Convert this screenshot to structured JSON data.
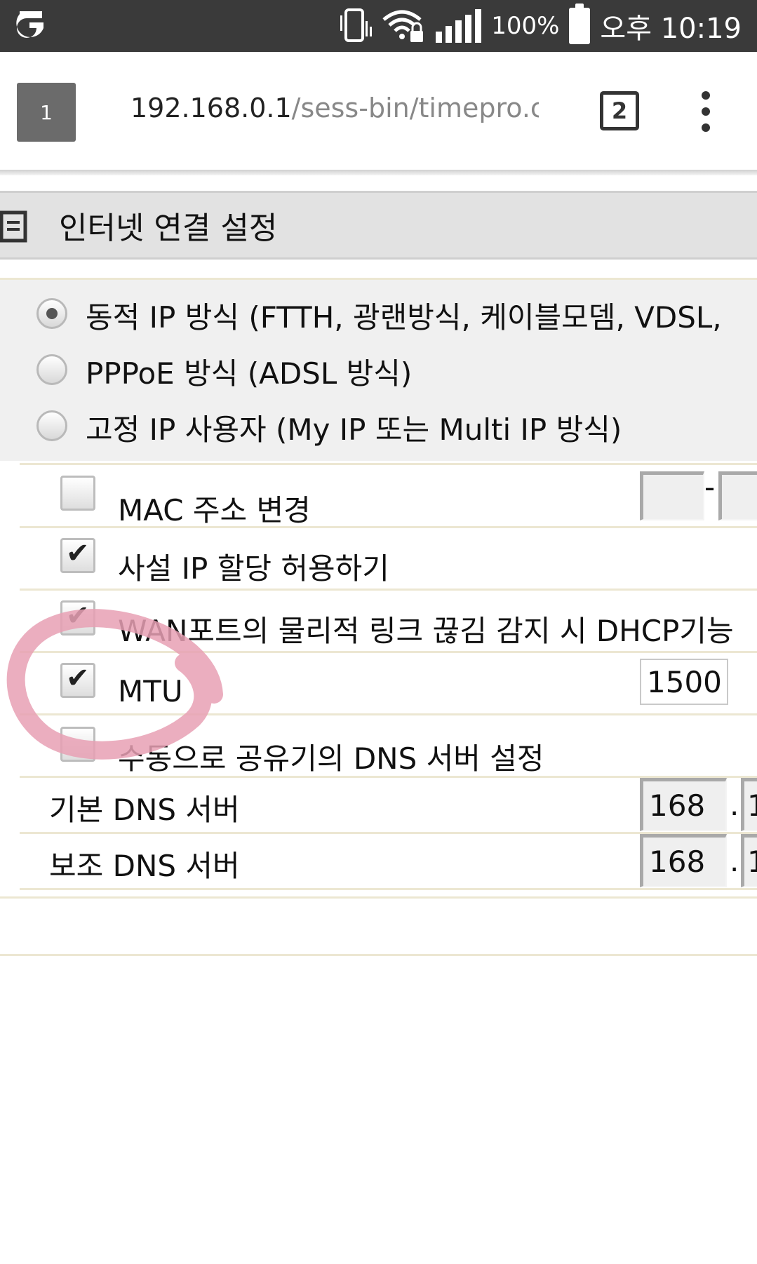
{
  "status_bar": {
    "battery_percent": "100%",
    "time": "오후 10:19",
    "icons": [
      "app-logo-icon",
      "vibrate-icon",
      "wifi-lock-icon",
      "signal-icon",
      "battery-icon"
    ]
  },
  "browser": {
    "tab_label": "1",
    "url_host": "192.168.0.1",
    "url_path": "/sess-bin/timepro.cgi?t",
    "tab_count": "2"
  },
  "section": {
    "title": "인터넷 연결 설정"
  },
  "connection_types": [
    {
      "label": "동적 IP 방식 (FTTH, 광랜방식, 케이블모뎀, VDSL, ",
      "selected": true
    },
    {
      "label": "PPPoE 방식 (ADSL 방식)",
      "selected": false
    },
    {
      "label": "고정 IP 사용자 (My IP 또는 Multi IP 방식)",
      "selected": false
    }
  ],
  "options": {
    "mac_change": {
      "label": "MAC 주소 변경",
      "checked": false,
      "separator": "-"
    },
    "private_ip": {
      "label": "사설 IP 할당 허용하기",
      "checked": true
    },
    "wan_dhcp": {
      "label": "WAN포트의 물리적 링크 끊김 감지 시 DHCP기능",
      "checked": true
    },
    "mtu": {
      "label": "MTU",
      "checked": true,
      "value": "1500"
    },
    "manual_dns": {
      "label": "수동으로 공유기의 DNS 서버 설정",
      "checked": false
    }
  },
  "dns": {
    "primary": {
      "label": "기본 DNS 서버",
      "octet1": "168",
      "separator": ".",
      "octet2_partial": "1"
    },
    "secondary": {
      "label": "보조 DNS 서버",
      "octet1": "168",
      "separator": ".",
      "octet2_partial": "1"
    }
  },
  "colors": {
    "status_bar_bg": "#3a3a3a",
    "section_header_bg": "#e2e2e2",
    "annotation_circle": "#e8a0b4"
  }
}
